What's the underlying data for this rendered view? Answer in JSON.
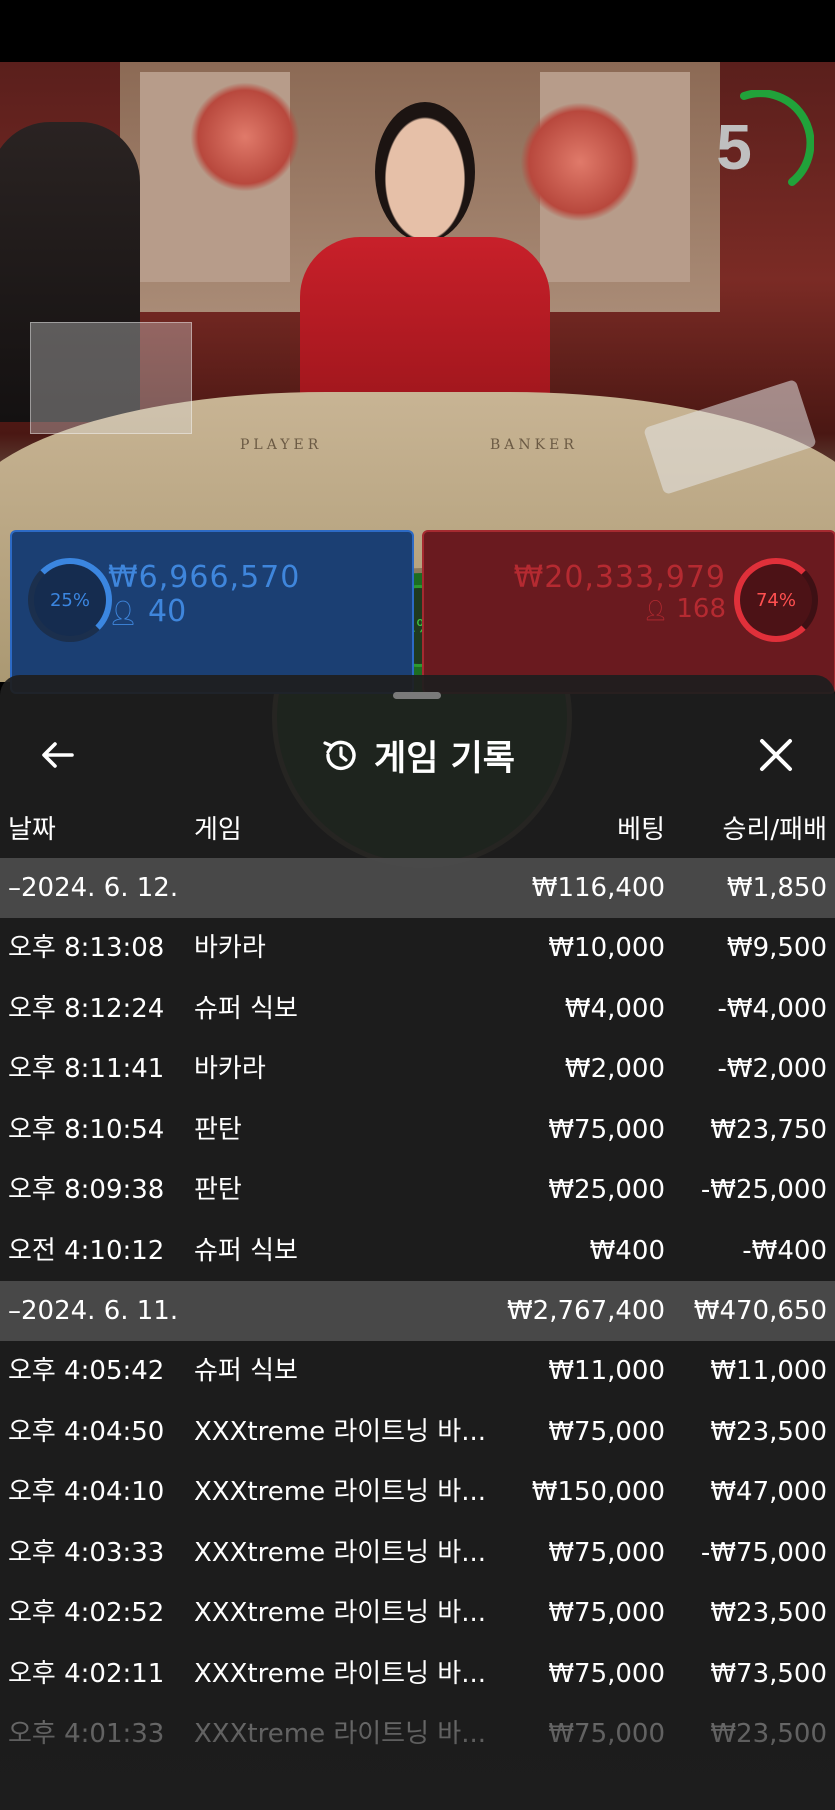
{
  "stream": {
    "countdown": "5",
    "table_labels": [
      "PLAYER",
      "BANKER"
    ]
  },
  "bets": {
    "player": {
      "percent": "25%",
      "amount": "₩6,966,570",
      "players": "40"
    },
    "banker": {
      "percent": "74%",
      "amount": "₩20,333,979",
      "players": "168"
    },
    "tie": {
      "percent": "1%"
    }
  },
  "modal": {
    "title": "게임 기록",
    "icons": {
      "back": "arrow-left-icon",
      "history": "history-icon",
      "close": "close-icon"
    },
    "columns": {
      "date": "날짜",
      "game": "게임",
      "bet": "베팅",
      "result": "승리/패배"
    },
    "groups": [
      {
        "date": "–2024. 6. 12.",
        "bet_total": "₩116,400",
        "result_total": "₩1,850",
        "rows": [
          {
            "time": "오후 8:13:08",
            "game": "바카라",
            "bet": "₩10,000",
            "result": "₩9,500"
          },
          {
            "time": "오후 8:12:24",
            "game": "슈퍼 식보",
            "bet": "₩4,000",
            "result": "-₩4,000"
          },
          {
            "time": "오후 8:11:41",
            "game": "바카라",
            "bet": "₩2,000",
            "result": "-₩2,000"
          },
          {
            "time": "오후 8:10:54",
            "game": "판탄",
            "bet": "₩75,000",
            "result": "₩23,750"
          },
          {
            "time": "오후 8:09:38",
            "game": "판탄",
            "bet": "₩25,000",
            "result": "-₩25,000"
          },
          {
            "time": "오전 4:10:12",
            "game": "슈퍼 식보",
            "bet": "₩400",
            "result": "-₩400"
          }
        ]
      },
      {
        "date": "–2024. 6. 11.",
        "bet_total": "₩2,767,400",
        "result_total": "₩470,650",
        "rows": [
          {
            "time": "오후 4:05:42",
            "game": "슈퍼 식보",
            "bet": "₩11,000",
            "result": "₩11,000"
          },
          {
            "time": "오후 4:04:50",
            "game": "XXXtreme 라이트닝 바...",
            "bet": "₩75,000",
            "result": "₩23,500"
          },
          {
            "time": "오후 4:04:10",
            "game": "XXXtreme 라이트닝 바...",
            "bet": "₩150,000",
            "result": "₩47,000"
          },
          {
            "time": "오후 4:03:33",
            "game": "XXXtreme 라이트닝 바...",
            "bet": "₩75,000",
            "result": "-₩75,000"
          },
          {
            "time": "오후 4:02:52",
            "game": "XXXtreme 라이트닝 바...",
            "bet": "₩75,000",
            "result": "₩23,500"
          },
          {
            "time": "오후 4:02:11",
            "game": "XXXtreme 라이트닝 바...",
            "bet": "₩75,000",
            "result": "₩73,500"
          },
          {
            "time": "오후 4:01:33",
            "game": "XXXtreme 라이트닝 바...",
            "bet": "₩75,000",
            "result": "₩23,500"
          }
        ]
      }
    ]
  }
}
